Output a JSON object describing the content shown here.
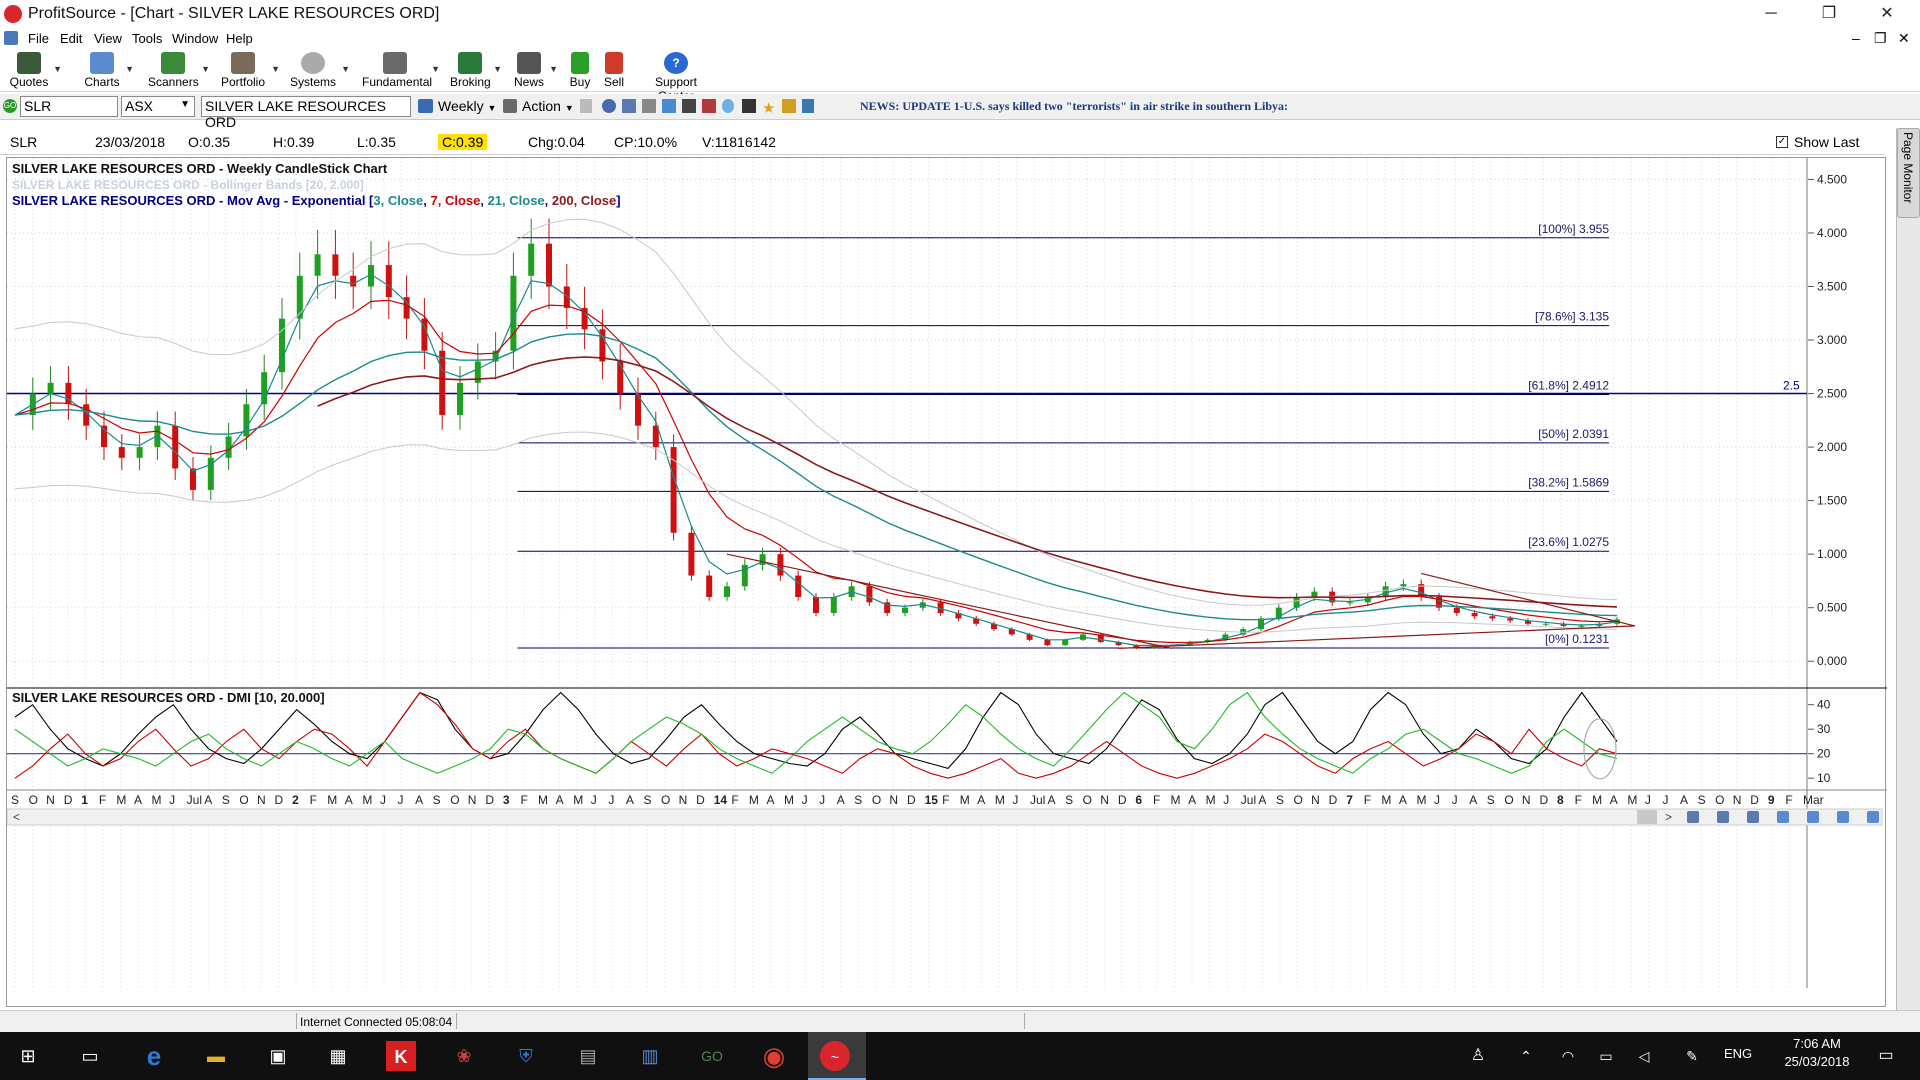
{
  "window": {
    "app_name": "ProfitSource",
    "title": "ProfitSource - [Chart - SILVER LAKE RESOURCES ORD]",
    "controls": [
      "─",
      "❐",
      "✕"
    ],
    "mdi_controls": [
      "–",
      "❐",
      "✕"
    ]
  },
  "menu": [
    "File",
    "Edit",
    "View",
    "Tools",
    "Window",
    "Help"
  ],
  "toolbar": [
    {
      "label": "Quotes",
      "icon": "quotes-icon"
    },
    {
      "label": "Charts",
      "icon": "charts-icon"
    },
    {
      "label": "Scanners",
      "icon": "scanners-icon"
    },
    {
      "label": "Portfolio",
      "icon": "portfolio-icon"
    },
    {
      "label": "Systems",
      "icon": "systems-icon"
    },
    {
      "label": "Fundamental",
      "icon": "fundamental-icon"
    },
    {
      "label": "Broking",
      "icon": "broking-icon"
    },
    {
      "label": "News",
      "icon": "news-icon"
    },
    {
      "label": "Buy",
      "icon": "buy-icon"
    },
    {
      "label": "Sell",
      "icon": "sell-icon"
    },
    {
      "label": "Support Center",
      "icon": "support-center-icon"
    }
  ],
  "security_bar": {
    "symbol": "SLR",
    "exchange": "ASX",
    "security_name": "SILVER LAKE RESOURCES ORD",
    "period": "Weekly",
    "action": "Action",
    "news": "NEWS: UPDATE 1-U.S. says killed two \"terrorists\" in air strike in southern Libya:"
  },
  "quote": {
    "code": "SLR",
    "date": "23/03/2018",
    "open": "O:0.35",
    "high": "H:0.39",
    "low": "L:0.35",
    "close": "C:0.39",
    "change": "Chg:0.04",
    "change_pct": "CP:10.0%",
    "volume": "V:11816142",
    "show_last": "Show Last"
  },
  "right_panel": {
    "label": "Page Monitor"
  },
  "chart_data": [
    {
      "type": "line",
      "title": "SILVER LAKE RESOURCES ORD - Weekly CandleStick Chart",
      "subtitle_bollinger": "SILVER LAKE RESOURCES ORD - Bollinger Bands [20, 2.000]",
      "ma_label_prefix": "SILVER LAKE RESOURCES ORD - Mov Avg - Exponential [",
      "ma_label_parts": [
        {
          "text": "3, Close",
          "color": "#1a8a8a"
        },
        {
          "text": ", ",
          "color": "#000080"
        },
        {
          "text": "7, Close",
          "color": "#cc0000"
        },
        {
          "text": ", ",
          "color": "#000080"
        },
        {
          "text": "21, Close",
          "color": "#1a8a8a"
        },
        {
          "text": ", ",
          "color": "#000080"
        },
        {
          "text": "200, Close",
          "color": "#8b1a1a"
        },
        {
          "text": "]",
          "color": "#000080"
        }
      ],
      "y_ticks": [
        "4.500",
        "4.000",
        "3.500",
        "3.000",
        "2.500",
        "2.000",
        "1.500",
        "1.000",
        "0.500",
        "0.000"
      ],
      "ylim": [
        -0.25,
        4.7
      ],
      "fib_levels": [
        {
          "label": "[100%] 3.955",
          "value": 3.955
        },
        {
          "label": "[78.6%] 3.135",
          "value": 3.135
        },
        {
          "label": "[61.8%] 2.4912",
          "value": 2.4912
        },
        {
          "label": "[50%] 2.0391",
          "value": 2.0391
        },
        {
          "label": "[38.2%] 1.5869",
          "value": 1.5869
        },
        {
          "label": "[23.6%] 1.0275",
          "value": 1.0275
        },
        {
          "label": "[0%] 0.1231",
          "value": 0.1231
        }
      ],
      "horizontal_line": {
        "label": "2.5",
        "value": 2.5
      },
      "x_labels": [
        "S",
        "O",
        "N",
        "D",
        "1",
        "F",
        "M",
        "A",
        "M",
        "J",
        "Jul",
        "A",
        "S",
        "O",
        "N",
        "D",
        "2",
        "F",
        "M",
        "A",
        "M",
        "J",
        "J",
        "A",
        "S",
        "O",
        "N",
        "D",
        "3",
        "F",
        "M",
        "A",
        "M",
        "J",
        "J",
        "A",
        "S",
        "O",
        "N",
        "D",
        "14",
        "F",
        "M",
        "A",
        "M",
        "J",
        "J",
        "A",
        "S",
        "O",
        "N",
        "D",
        "15",
        "F",
        "M",
        "A",
        "M",
        "J",
        "Jul",
        "A",
        "S",
        "O",
        "N",
        "D",
        "6",
        "F",
        "M",
        "A",
        "M",
        "J",
        "Jul",
        "A",
        "S",
        "O",
        "N",
        "D",
        "7",
        "F",
        "M",
        "A",
        "M",
        "J",
        "J",
        "A",
        "S",
        "O",
        "N",
        "D",
        "8",
        "F",
        "M",
        "A",
        "M",
        "J",
        "J",
        "A",
        "S",
        "O",
        "N",
        "D",
        "9",
        "F",
        "Mar"
      ],
      "close_series": [
        2.3,
        2.5,
        2.6,
        2.4,
        2.2,
        2.0,
        1.9,
        2.0,
        2.2,
        1.8,
        1.6,
        1.9,
        2.1,
        2.4,
        2.7,
        3.2,
        3.6,
        3.8,
        3.6,
        3.5,
        3.7,
        3.4,
        3.2,
        2.9,
        2.3,
        2.6,
        2.8,
        2.9,
        3.6,
        3.9,
        3.5,
        3.3,
        3.1,
        2.8,
        2.5,
        2.2,
        2.0,
        1.2,
        0.8,
        0.6,
        0.7,
        0.9,
        1.0,
        0.8,
        0.6,
        0.45,
        0.6,
        0.7,
        0.55,
        0.45,
        0.5,
        0.55,
        0.45,
        0.4,
        0.35,
        0.3,
        0.25,
        0.2,
        0.15,
        0.2,
        0.25,
        0.18,
        0.15,
        0.12,
        0.15,
        0.15,
        0.18,
        0.2,
        0.25,
        0.3,
        0.4,
        0.5,
        0.6,
        0.65,
        0.55,
        0.55,
        0.6,
        0.7,
        0.72,
        0.6,
        0.5,
        0.45,
        0.42,
        0.4,
        0.38,
        0.35,
        0.35,
        0.33,
        0.33,
        0.35,
        0.39
      ]
    },
    {
      "type": "line",
      "title": "SILVER LAKE RESOURCES ORD - DMI [10, 20.000]",
      "y_ticks": [
        "40",
        "30",
        "20",
        "10"
      ],
      "ylim": [
        6,
        46
      ],
      "threshold": 20,
      "series": [
        {
          "color": "#000000",
          "values": [
            35,
            40,
            30,
            22,
            18,
            15,
            20,
            28,
            35,
            40,
            30,
            22,
            18,
            16,
            22,
            30,
            38,
            32,
            25,
            20,
            18,
            25,
            35,
            45,
            42,
            30,
            22,
            18,
            20,
            28,
            38,
            45,
            38,
            28,
            20,
            16,
            18,
            26,
            35,
            40,
            32,
            25,
            20,
            18,
            16,
            15,
            20,
            30,
            35,
            28,
            20,
            18,
            16,
            14,
            22,
            35,
            45,
            40,
            28,
            20,
            18,
            16,
            22,
            32,
            42,
            38,
            26,
            18,
            16,
            20,
            28,
            40,
            45,
            35,
            25,
            20,
            25,
            38,
            45,
            40,
            28,
            20,
            22,
            30,
            25,
            18,
            16,
            22,
            35,
            45,
            35,
            25
          ]
        },
        {
          "color": "#cc0000",
          "values": [
            10,
            15,
            22,
            28,
            20,
            15,
            18,
            25,
            30,
            22,
            15,
            18,
            25,
            30,
            22,
            18,
            25,
            30,
            28,
            22,
            15,
            25,
            35,
            45,
            40,
            32,
            22,
            18,
            25,
            30,
            22,
            18,
            15,
            12,
            18,
            25,
            20,
            15,
            22,
            28,
            20,
            15,
            18,
            22,
            20,
            18,
            15,
            12,
            18,
            22,
            20,
            15,
            12,
            10,
            12,
            15,
            18,
            12,
            10,
            12,
            15,
            20,
            25,
            20,
            15,
            12,
            10,
            12,
            15,
            18,
            22,
            28,
            25,
            20,
            15,
            12,
            18,
            22,
            25,
            20,
            15,
            18,
            22,
            28,
            25,
            20,
            30,
            22,
            18,
            15,
            22,
            20
          ]
        },
        {
          "color": "#22bb22",
          "values": [
            30,
            25,
            20,
            15,
            18,
            22,
            20,
            18,
            15,
            20,
            25,
            28,
            22,
            18,
            15,
            20,
            25,
            22,
            18,
            15,
            20,
            25,
            18,
            15,
            12,
            15,
            18,
            22,
            30,
            28,
            22,
            18,
            15,
            12,
            18,
            25,
            30,
            35,
            32,
            28,
            22,
            18,
            15,
            12,
            18,
            25,
            30,
            35,
            30,
            25,
            22,
            20,
            25,
            32,
            40,
            35,
            28,
            22,
            18,
            15,
            22,
            30,
            38,
            45,
            40,
            35,
            25,
            22,
            30,
            40,
            45,
            35,
            28,
            22,
            18,
            15,
            12,
            18,
            22,
            28,
            30,
            25,
            20,
            18,
            15,
            12,
            15,
            25,
            30,
            25,
            20,
            18
          ]
        }
      ]
    }
  ],
  "status": {
    "connection": "Internet Connected 05:08:04"
  },
  "taskbar": {
    "time": "7:06 AM",
    "date": "25/03/2018",
    "lang": "ENG"
  }
}
